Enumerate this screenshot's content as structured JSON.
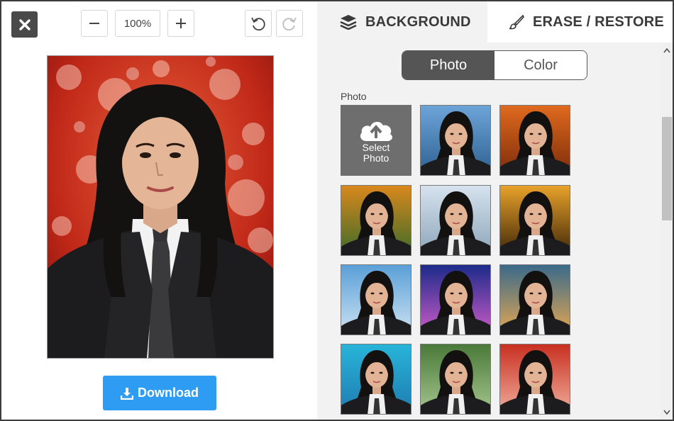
{
  "toolbar": {
    "zoom": "100%"
  },
  "download_label": "Download",
  "tabs": {
    "background": "BACKGROUND",
    "erase": "ERASE / RESTORE"
  },
  "segment": {
    "photo": "Photo",
    "color": "Color"
  },
  "section_label": "Photo",
  "select_photo": {
    "line1": "Select",
    "line2": "Photo"
  },
  "thumbnails": [
    {
      "scene": "mountain-lake",
      "bg1": "#6da4d8",
      "bg2": "#2c5f8f"
    },
    {
      "scene": "autumn-forest",
      "bg1": "#e06a1e",
      "bg2": "#7a2a0a"
    },
    {
      "scene": "colored-stripes",
      "bg1": "#d9881c",
      "bg2": "#3a6b2a"
    },
    {
      "scene": "winter-trees",
      "bg1": "#d6e2ee",
      "bg2": "#8aa4b8"
    },
    {
      "scene": "sunset-trees",
      "bg1": "#e8a22a",
      "bg2": "#3c2408"
    },
    {
      "scene": "beach-sky",
      "bg1": "#5aa0d8",
      "bg2": "#cfe3f2"
    },
    {
      "scene": "night-city",
      "bg1": "#1c2b8a",
      "bg2": "#d05cc8"
    },
    {
      "scene": "bokeh-lights",
      "bg1": "#3a6a8a",
      "bg2": "#e8a850"
    },
    {
      "scene": "ocean-pier",
      "bg1": "#28b4d8",
      "bg2": "#1e7ab0"
    },
    {
      "scene": "green-forest",
      "bg1": "#4a7a3a",
      "bg2": "#a8c890"
    },
    {
      "scene": "red-bokeh",
      "bg1": "#c83020",
      "bg2": "#f2b0a0"
    }
  ],
  "colors": {
    "download": "#2f9cf4",
    "segment_active": "#555555",
    "panel": "#f2f2f2"
  }
}
